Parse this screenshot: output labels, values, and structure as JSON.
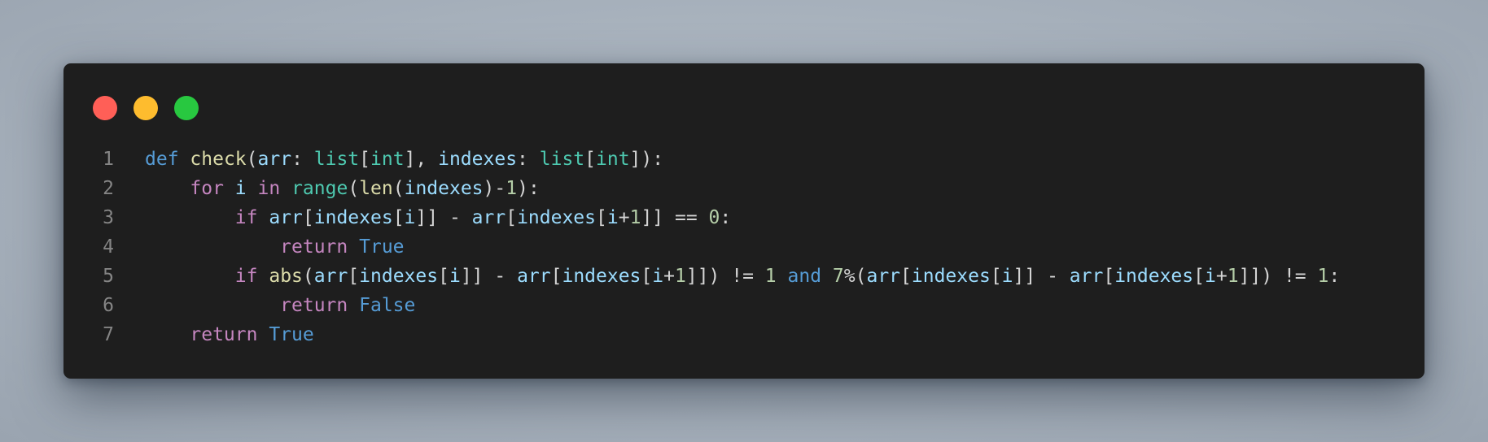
{
  "window": {
    "buttons": [
      {
        "name": "close",
        "color": "#ff5f57"
      },
      {
        "name": "minimize",
        "color": "#febc2e"
      },
      {
        "name": "zoom",
        "color": "#28c840"
      }
    ]
  },
  "code": {
    "lines": [
      {
        "num": "1",
        "tokens": [
          {
            "t": "def",
            "c": "kw-def"
          },
          {
            "t": " ",
            "c": "op"
          },
          {
            "t": "check",
            "c": "fn"
          },
          {
            "t": "(",
            "c": "op"
          },
          {
            "t": "arr",
            "c": "var"
          },
          {
            "t": ": ",
            "c": "op"
          },
          {
            "t": "list",
            "c": "type"
          },
          {
            "t": "[",
            "c": "op"
          },
          {
            "t": "int",
            "c": "type"
          },
          {
            "t": "], ",
            "c": "op"
          },
          {
            "t": "indexes",
            "c": "var"
          },
          {
            "t": ": ",
            "c": "op"
          },
          {
            "t": "list",
            "c": "type"
          },
          {
            "t": "[",
            "c": "op"
          },
          {
            "t": "int",
            "c": "type"
          },
          {
            "t": "]):",
            "c": "op"
          }
        ]
      },
      {
        "num": "2",
        "tokens": [
          {
            "t": "    ",
            "c": "op"
          },
          {
            "t": "for",
            "c": "kw-ctrl"
          },
          {
            "t": " ",
            "c": "op"
          },
          {
            "t": "i",
            "c": "var"
          },
          {
            "t": " ",
            "c": "op"
          },
          {
            "t": "in",
            "c": "kw-ctrl"
          },
          {
            "t": " ",
            "c": "op"
          },
          {
            "t": "range",
            "c": "type"
          },
          {
            "t": "(",
            "c": "op"
          },
          {
            "t": "len",
            "c": "fn"
          },
          {
            "t": "(",
            "c": "op"
          },
          {
            "t": "indexes",
            "c": "var"
          },
          {
            "t": ")-",
            "c": "op"
          },
          {
            "t": "1",
            "c": "num"
          },
          {
            "t": "):",
            "c": "op"
          }
        ]
      },
      {
        "num": "3",
        "tokens": [
          {
            "t": "        ",
            "c": "op"
          },
          {
            "t": "if",
            "c": "kw-ctrl"
          },
          {
            "t": " ",
            "c": "op"
          },
          {
            "t": "arr",
            "c": "var"
          },
          {
            "t": "[",
            "c": "op"
          },
          {
            "t": "indexes",
            "c": "var"
          },
          {
            "t": "[",
            "c": "op"
          },
          {
            "t": "i",
            "c": "var"
          },
          {
            "t": "]] - ",
            "c": "op"
          },
          {
            "t": "arr",
            "c": "var"
          },
          {
            "t": "[",
            "c": "op"
          },
          {
            "t": "indexes",
            "c": "var"
          },
          {
            "t": "[",
            "c": "op"
          },
          {
            "t": "i",
            "c": "var"
          },
          {
            "t": "+",
            "c": "op"
          },
          {
            "t": "1",
            "c": "num"
          },
          {
            "t": "]] == ",
            "c": "op"
          },
          {
            "t": "0",
            "c": "num"
          },
          {
            "t": ":",
            "c": "op"
          }
        ]
      },
      {
        "num": "4",
        "tokens": [
          {
            "t": "            ",
            "c": "op"
          },
          {
            "t": "return",
            "c": "kw-ctrl"
          },
          {
            "t": " ",
            "c": "op"
          },
          {
            "t": "True",
            "c": "const"
          }
        ]
      },
      {
        "num": "5",
        "tokens": [
          {
            "t": "        ",
            "c": "op"
          },
          {
            "t": "if",
            "c": "kw-ctrl"
          },
          {
            "t": " ",
            "c": "op"
          },
          {
            "t": "abs",
            "c": "fn"
          },
          {
            "t": "(",
            "c": "op"
          },
          {
            "t": "arr",
            "c": "var"
          },
          {
            "t": "[",
            "c": "op"
          },
          {
            "t": "indexes",
            "c": "var"
          },
          {
            "t": "[",
            "c": "op"
          },
          {
            "t": "i",
            "c": "var"
          },
          {
            "t": "]] - ",
            "c": "op"
          },
          {
            "t": "arr",
            "c": "var"
          },
          {
            "t": "[",
            "c": "op"
          },
          {
            "t": "indexes",
            "c": "var"
          },
          {
            "t": "[",
            "c": "op"
          },
          {
            "t": "i",
            "c": "var"
          },
          {
            "t": "+",
            "c": "op"
          },
          {
            "t": "1",
            "c": "num"
          },
          {
            "t": "]]) != ",
            "c": "op"
          },
          {
            "t": "1",
            "c": "num"
          },
          {
            "t": " ",
            "c": "op"
          },
          {
            "t": "and",
            "c": "kw-def"
          },
          {
            "t": " ",
            "c": "op"
          },
          {
            "t": "7",
            "c": "num"
          },
          {
            "t": "%(",
            "c": "op"
          },
          {
            "t": "arr",
            "c": "var"
          },
          {
            "t": "[",
            "c": "op"
          },
          {
            "t": "indexes",
            "c": "var"
          },
          {
            "t": "[",
            "c": "op"
          },
          {
            "t": "i",
            "c": "var"
          },
          {
            "t": "]] - ",
            "c": "op"
          },
          {
            "t": "arr",
            "c": "var"
          },
          {
            "t": "[",
            "c": "op"
          },
          {
            "t": "indexes",
            "c": "var"
          },
          {
            "t": "[",
            "c": "op"
          },
          {
            "t": "i",
            "c": "var"
          },
          {
            "t": "+",
            "c": "op"
          },
          {
            "t": "1",
            "c": "num"
          },
          {
            "t": "]]) != ",
            "c": "op"
          },
          {
            "t": "1",
            "c": "num"
          },
          {
            "t": ":",
            "c": "op"
          }
        ]
      },
      {
        "num": "6",
        "tokens": [
          {
            "t": "            ",
            "c": "op"
          },
          {
            "t": "return",
            "c": "kw-ctrl"
          },
          {
            "t": " ",
            "c": "op"
          },
          {
            "t": "False",
            "c": "const"
          }
        ]
      },
      {
        "num": "7",
        "tokens": [
          {
            "t": "    ",
            "c": "op"
          },
          {
            "t": "return",
            "c": "kw-ctrl"
          },
          {
            "t": " ",
            "c": "op"
          },
          {
            "t": "True",
            "c": "const"
          }
        ]
      }
    ]
  }
}
